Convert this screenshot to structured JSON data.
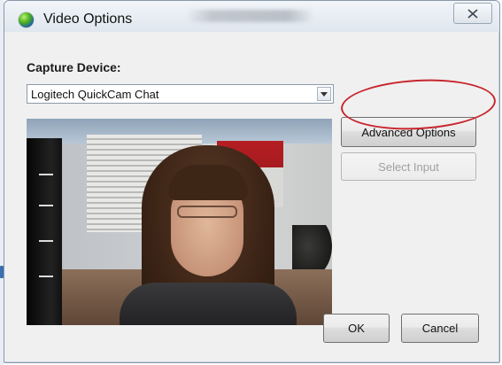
{
  "window": {
    "title": "Video Options",
    "title_obscured": true
  },
  "capture": {
    "label": "Capture Device:",
    "device": "Logitech QuickCam Chat"
  },
  "buttons": {
    "advanced": "Advanced Options",
    "select_input": "Select Input",
    "ok": "OK",
    "cancel": "Cancel"
  },
  "colors": {
    "annotation": "#c8262e",
    "disabled_text": "#a0a0a0"
  },
  "icons": {
    "app": "app-globe-icon",
    "close": "close-icon",
    "dropdown": "chevron-down-icon"
  }
}
